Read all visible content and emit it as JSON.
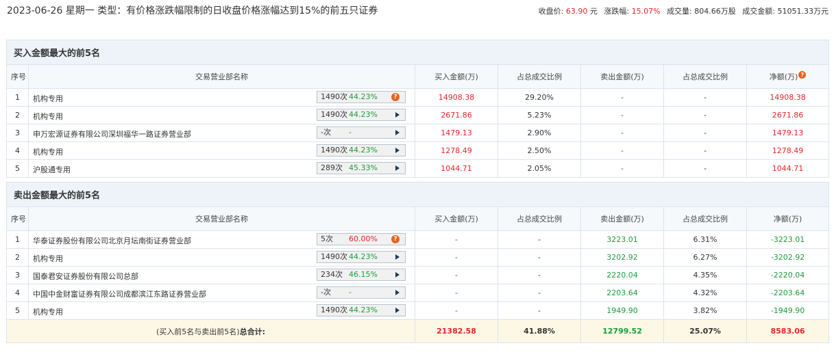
{
  "header": {
    "title": "2023-06-26 星期一 类型：有价格涨跌幅限制的日收盘价格涨幅达到15%的前五只证券",
    "stats": {
      "close_label": "收盘价:",
      "close_value": "63.90",
      "close_unit": "元",
      "change_label": "涨跌幅:",
      "change_value": "15.07%",
      "volume_label": "成交量:",
      "volume_value": "804.66万股",
      "amount_label": "成交金额:",
      "amount_value": "51051.33万元"
    }
  },
  "buy_section": {
    "title": "买入金额最大的前5名",
    "columns": [
      "序号",
      "交易营业部名称",
      "买入金额(万)",
      "占总成交比例",
      "卖出金额(万)",
      "占总成交比例",
      "净额(万)"
    ],
    "rows": [
      {
        "idx": "1",
        "name": "机构专用",
        "count": "1490次",
        "rate": "44.23%",
        "buy": "14908.38",
        "buy_pct": "29.20%",
        "sell": "-",
        "sell_pct": "-",
        "net": "14908.38",
        "icon": "help-icon"
      },
      {
        "idx": "2",
        "name": "机构专用",
        "count": "1490次",
        "rate": "44.23%",
        "buy": "2671.86",
        "buy_pct": "5.23%",
        "sell": "-",
        "sell_pct": "-",
        "net": "2671.86",
        "icon": "arrow-right-icon"
      },
      {
        "idx": "3",
        "name": "申万宏源证券有限公司深圳福华一路证券营业部",
        "count": "-次",
        "rate": "-",
        "buy": "1479.13",
        "buy_pct": "2.90%",
        "sell": "-",
        "sell_pct": "-",
        "net": "1479.13",
        "icon": "arrow-right-icon"
      },
      {
        "idx": "4",
        "name": "机构专用",
        "count": "1490次",
        "rate": "44.23%",
        "buy": "1278.49",
        "buy_pct": "2.50%",
        "sell": "-",
        "sell_pct": "-",
        "net": "1278.49",
        "icon": "arrow-right-icon"
      },
      {
        "idx": "5",
        "name": "沪股通专用",
        "count": "289次",
        "rate": "45.33%",
        "buy": "1044.71",
        "buy_pct": "2.05%",
        "sell": "-",
        "sell_pct": "-",
        "net": "1044.71",
        "icon": "arrow-right-icon"
      }
    ]
  },
  "sell_section": {
    "title": "卖出金额最大的前5名",
    "columns": [
      "序号",
      "交易营业部名称",
      "买入金额(万)",
      "占总成交比例",
      "卖出金额(万)",
      "占总成交比例",
      "净额(万)"
    ],
    "rows": [
      {
        "idx": "1",
        "name": "华泰证券股份有限公司北京月坛南街证券营业部",
        "count": "5次",
        "rate": "60.00%",
        "buy": "-",
        "buy_pct": "-",
        "sell": "3223.01",
        "sell_pct": "6.31%",
        "net": "-3223.01",
        "icon": "help-icon"
      },
      {
        "idx": "2",
        "name": "机构专用",
        "count": "1490次",
        "rate": "44.23%",
        "buy": "-",
        "buy_pct": "-",
        "sell": "3202.92",
        "sell_pct": "6.27%",
        "net": "-3202.92",
        "icon": "arrow-right-icon"
      },
      {
        "idx": "3",
        "name": "国泰君安证券股份有限公司总部",
        "count": "234次",
        "rate": "46.15%",
        "buy": "-",
        "buy_pct": "-",
        "sell": "2220.04",
        "sell_pct": "4.35%",
        "net": "-2220.04",
        "icon": "arrow-right-icon"
      },
      {
        "idx": "4",
        "name": "中国中金财富证券有限公司成都滨江东路证券营业部",
        "count": "-次",
        "rate": "-",
        "buy": "-",
        "buy_pct": "-",
        "sell": "2203.64",
        "sell_pct": "4.32%",
        "net": "-2203.64",
        "icon": "arrow-right-icon"
      },
      {
        "idx": "5",
        "name": "机构专用",
        "count": "1490次",
        "rate": "44.23%",
        "buy": "-",
        "buy_pct": "-",
        "sell": "1949.90",
        "sell_pct": "3.82%",
        "net": "-1949.90",
        "icon": "arrow-right-icon"
      }
    ]
  },
  "total": {
    "label_prefix": "(买入前5名与卖出前5名)",
    "label_bold": "总合计:",
    "buy": "21382.58",
    "buy_pct": "41.88%",
    "sell": "12799.52",
    "sell_pct": "25.07%",
    "net": "8583.06"
  },
  "colors": {
    "red": "#e5232a",
    "green": "#1d9b3b",
    "header_bg": "#eef3fa",
    "total_bg": "#fdf8e6"
  }
}
